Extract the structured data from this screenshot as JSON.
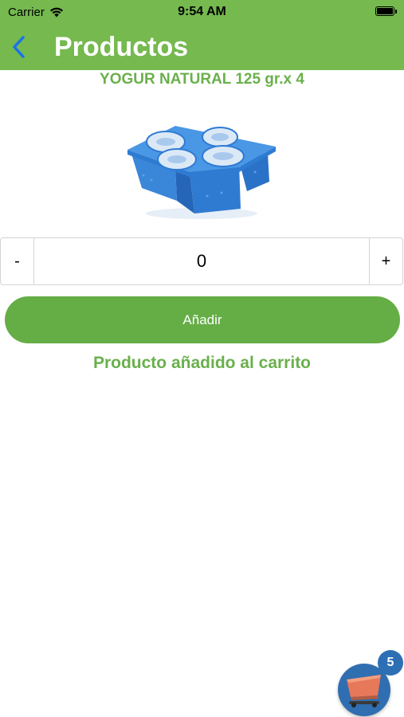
{
  "status_bar": {
    "carrier": "Carrier",
    "time": "9:54 AM"
  },
  "nav": {
    "title": "Productos",
    "back_icon": "chevron-left-icon"
  },
  "product": {
    "name": "YOGUR NATURAL 125 gr.x 4",
    "image": "yogurt-4pack-image"
  },
  "stepper": {
    "minus_label": "-",
    "value": "0",
    "plus_label": "+"
  },
  "add_button": {
    "label": "Añadir"
  },
  "message": {
    "text": "Producto añadido al carrito"
  },
  "cart": {
    "count": "5",
    "icon": "shopping-cart-icon"
  },
  "colors": {
    "header": "#75b94f",
    "accent_green": "#6ab04c",
    "button_green": "#65ad45",
    "back_blue": "#1a73e8",
    "cart_blue": "#2f6eb0"
  }
}
